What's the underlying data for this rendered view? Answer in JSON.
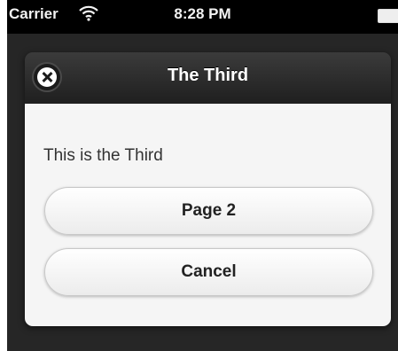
{
  "status_bar": {
    "carrier": "Carrier",
    "time": "8:28 PM",
    "wifi_icon": "wifi-icon",
    "battery_icon": "battery-icon"
  },
  "dialog": {
    "title": "The Third",
    "close_icon": "close-icon",
    "body_text": "This is the Third",
    "buttons": [
      {
        "label": "Page 2"
      },
      {
        "label": "Cancel"
      }
    ]
  },
  "colors": {
    "header_dark": "#1f1f1f",
    "body_bg": "#f5f5f5",
    "overlay": "#262626"
  }
}
